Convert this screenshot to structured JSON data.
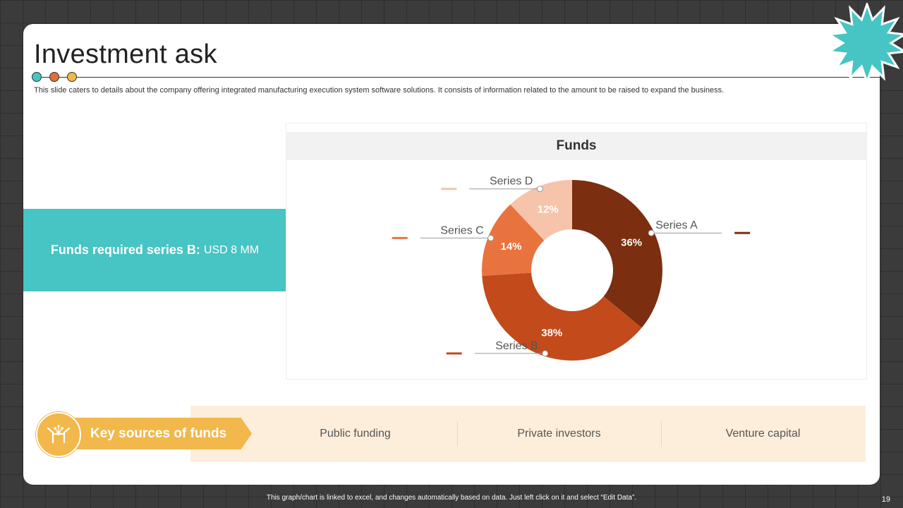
{
  "slide": {
    "title": "Investment ask",
    "subtitle": "This slide caters to details about the company offering integrated manufacturing execution system software solutions. It consists of information related to the amount to be raised to expand the business.",
    "dot_colors": [
      "#47c4c4",
      "#e2703a",
      "#f2b84b"
    ]
  },
  "funds_box": {
    "label": "Funds required series B:",
    "value": "USD 8 MM",
    "color": "#47c4c4"
  },
  "chart_data": {
    "type": "pie",
    "variant": "donut",
    "title": "Funds",
    "categories": [
      "Series A",
      "Series B",
      "Series C",
      "Series D"
    ],
    "values": [
      36,
      38,
      14,
      12
    ],
    "labels": [
      "36%",
      "38%",
      "14%",
      "12%"
    ],
    "colors": [
      "#7b2e10",
      "#c24a1b",
      "#e8733f",
      "#f6c4ab"
    ],
    "units": "%"
  },
  "sources": {
    "label": "Key sources of funds",
    "icon": "hands-network-icon",
    "items": [
      "Public funding",
      "Private investors",
      "Venture capital"
    ],
    "accent_color": "#f2b84b",
    "band_color": "#fdeedb"
  },
  "decor": {
    "starburst_color": "#47c4c4"
  },
  "footer": {
    "note": "This graph/chart is linked to excel, and changes automatically based on data. Just left click on it and select “Edit Data”.",
    "page_number": "19"
  }
}
